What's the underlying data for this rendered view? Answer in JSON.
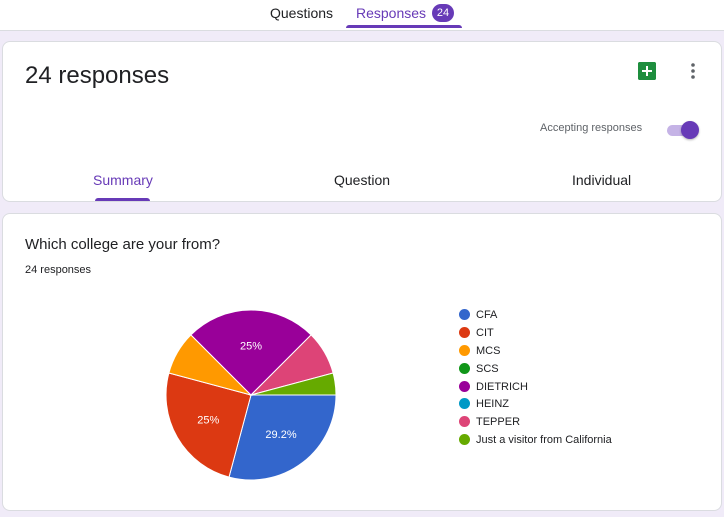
{
  "top_tabs": {
    "questions": "Questions",
    "responses": "Responses",
    "responses_count": "24"
  },
  "header": {
    "title": "24 responses",
    "accepting_label": "Accepting responses",
    "accepting": true,
    "sheets_icon": "google-sheets-icon",
    "more_icon": "more-vert-icon"
  },
  "subtabs": {
    "summary": "Summary",
    "question": "Question",
    "individual": "Individual"
  },
  "question": {
    "title": "Which college are your from?",
    "count": "24 responses"
  },
  "colors": {
    "accent": "#673ab7",
    "background": "#f0ebf8"
  },
  "chart_data": {
    "type": "pie",
    "total_responses": 24,
    "slices": [
      {
        "label": "CFA",
        "value": 7,
        "color": "#3366cc",
        "display": "29.2%"
      },
      {
        "label": "CIT",
        "value": 6,
        "color": "#dc3912",
        "display": "25%"
      },
      {
        "label": "MCS",
        "value": 2,
        "color": "#ff9900",
        "display": ""
      },
      {
        "label": "SCS",
        "value": 0,
        "color": "#109618",
        "display": ""
      },
      {
        "label": "DIETRICH",
        "value": 6,
        "color": "#990099",
        "display": "25%"
      },
      {
        "label": "HEINZ",
        "value": 0,
        "color": "#0099c6",
        "display": ""
      },
      {
        "label": "TEPPER",
        "value": 2,
        "color": "#dd4477",
        "display": ""
      },
      {
        "label": "Just a visitor from California",
        "value": 1,
        "color": "#66aa00",
        "display": ""
      }
    ],
    "legend_position": "right"
  }
}
